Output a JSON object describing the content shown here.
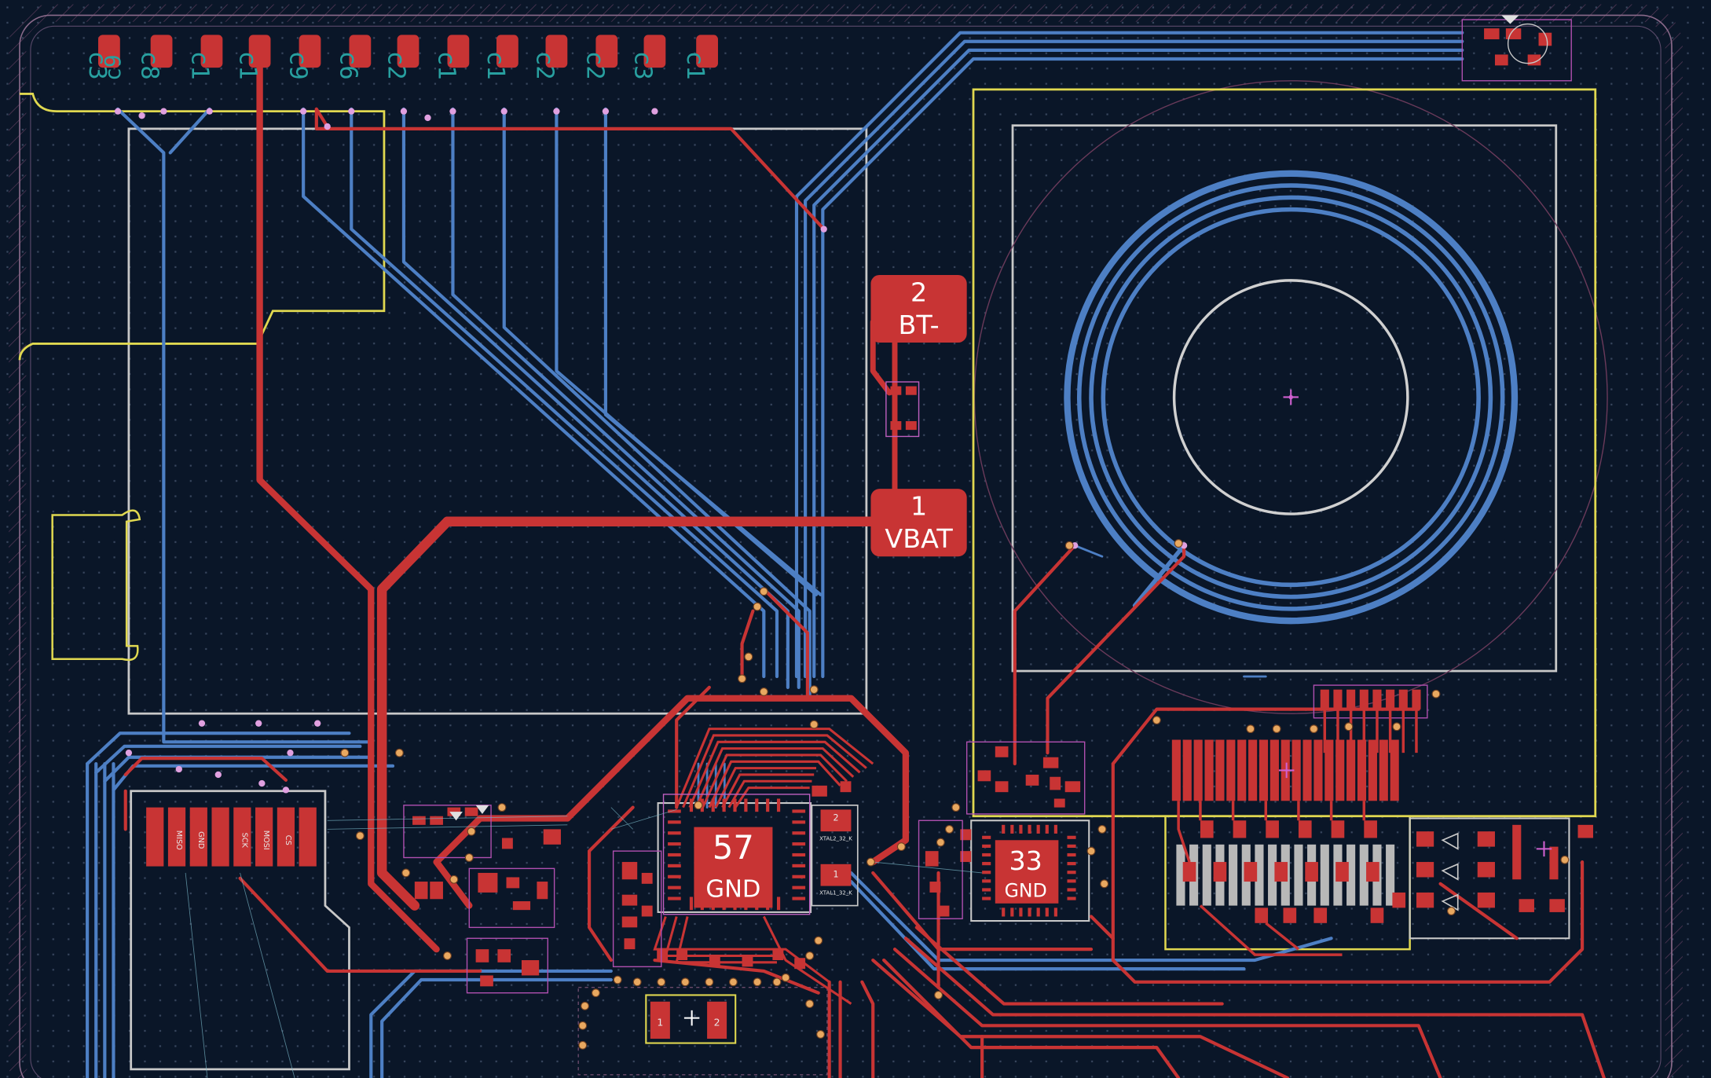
{
  "pads": {
    "bt_minus": {
      "number": "2",
      "name": "BT-"
    },
    "vbat": {
      "number": "1",
      "name": "VBAT"
    },
    "mcu_gnd": {
      "number": "57",
      "name": "GND"
    },
    "ic2_gnd": {
      "number": "33",
      "name": "GND"
    }
  },
  "connector_pins": [
    "MISO",
    "GND",
    "SCK",
    "MOSI",
    "CS"
  ],
  "crystal_labels": [
    "XTAL1_32_K",
    "XTAL2_32_K"
  ],
  "colors": {
    "background": "#0a1628",
    "front_copper": "#c83434",
    "back_copper": "#4d7fc4",
    "silkscreen": "#d8d8d8",
    "courtyard": "#e0d850",
    "outline": "#8a6a8a",
    "dot_grid": "#38465e"
  }
}
